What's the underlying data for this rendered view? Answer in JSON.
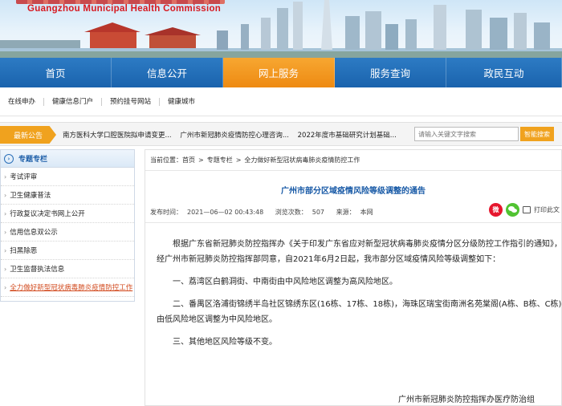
{
  "header": {
    "english_name": "Guangzhou Municipal Health Commission"
  },
  "main_nav": [
    {
      "label": "首页",
      "width": 139,
      "active": false
    },
    {
      "label": "信息公开",
      "width": 139,
      "active": false
    },
    {
      "label": "网上服务",
      "width": 139,
      "active": true
    },
    {
      "label": "服务查询",
      "width": 139,
      "active": false
    },
    {
      "label": "政民互动",
      "width": 144,
      "active": false
    }
  ],
  "sub_nav": [
    "在线申办",
    "健康信息门户",
    "预约挂号网站",
    "健康城市"
  ],
  "notice": {
    "label": "最新公告",
    "items": [
      "南方医科大学口腔医院拟申请变更...",
      "广州市新冠肺炎疫情防控心理咨询...",
      "2022年度市基础研究计划基础..."
    ]
  },
  "search": {
    "placeholder": "请输入关键文字搜索",
    "button_label": "智能搜索"
  },
  "sidebar": {
    "title": "专题专栏",
    "items": [
      {
        "label": "考试评审",
        "active": false
      },
      {
        "label": "卫生健康普法",
        "active": false
      },
      {
        "label": "行政复议决定书网上公开",
        "active": false
      },
      {
        "label": "信用信息双公示",
        "active": false
      },
      {
        "label": "扫黑除恶",
        "active": false
      },
      {
        "label": "卫生监督执法信息",
        "active": false
      },
      {
        "label": "全力做好新型冠状病毒肺炎疫情防控工作",
        "active": true
      }
    ]
  },
  "breadcrumb": {
    "prefix": "当前位置：",
    "items": [
      "首页",
      "专题专栏",
      "全力做好新型冠状病毒肺炎疫情防控工作"
    ]
  },
  "article": {
    "title": "广州市部分区域疫情风险等级调整的通告",
    "publish_label": "发布时间：",
    "publish_time": "2021—06—02 00:43:48",
    "views_label": "浏览次数：",
    "views": "507",
    "source_label": "来源：",
    "source": "本网",
    "print_label": "打印此文",
    "paragraphs": [
      "根据广东省新冠肺炎防控指挥办《关于印发广东省应对新型冠状病毒肺炎疫情分区分级防控工作指引的通知》，经广州市新冠肺炎防控指挥部同意，自2021年6月2日起，我市部分区域疫情风险等级调整如下：",
      "一、荔湾区白鹤洞街、中南街由中风险地区调整为高风险地区。",
      "二、番禺区洛浦街锦绣半岛社区锦绣东区(16栋、17栋、18栋)，海珠区瑞宝街南洲名苑棠阁(A栋、B栋、C栋)由低风险地区调整为中风险地区。",
      "三、其他地区风险等级不变。"
    ],
    "signature": "广州市新冠肺炎防控指挥办医疗防治组"
  }
}
